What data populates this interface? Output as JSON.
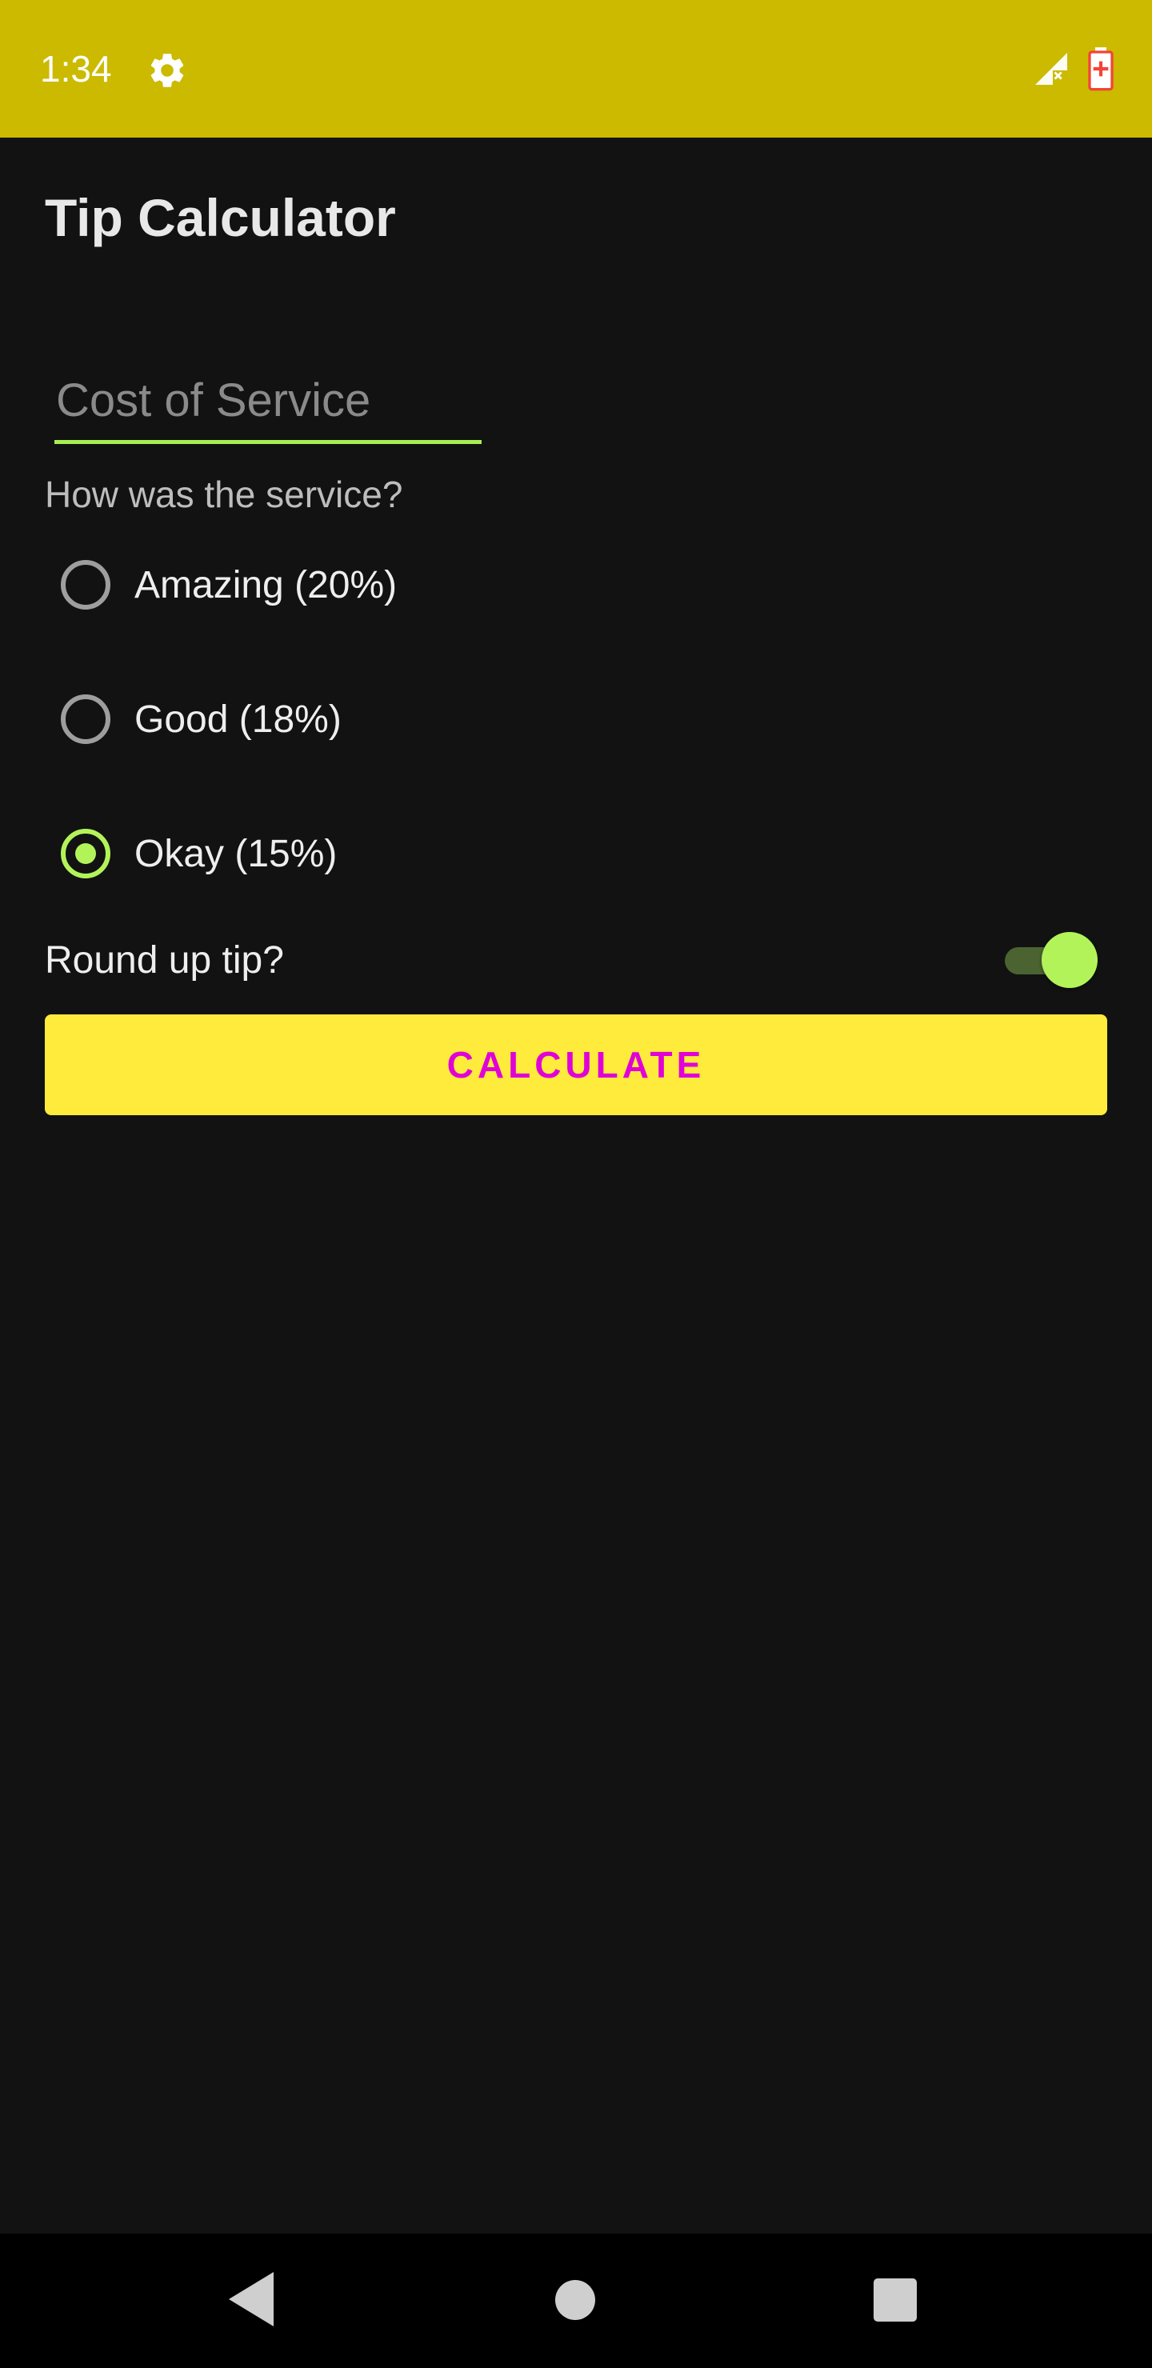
{
  "status_bar": {
    "time": "1:34",
    "background_color": "#cbba00",
    "icons": [
      "gear-icon",
      "signal-icon",
      "battery-icon"
    ]
  },
  "app": {
    "title": "Tip Calculator"
  },
  "cost_input": {
    "placeholder": "Cost of Service",
    "value": "",
    "accent_color": "#a6ef52"
  },
  "service": {
    "question": "How was the service?",
    "options": [
      {
        "label": "Amazing (20%)",
        "checked": false
      },
      {
        "label": "Good (18%)",
        "checked": false
      },
      {
        "label": "Okay (15%)",
        "checked": true
      }
    ]
  },
  "round_up": {
    "label": "Round up tip?",
    "enabled": true
  },
  "calculate_button": {
    "label": "CALCULATE",
    "background_color": "#ffeb3b",
    "text_color": "#e000d8"
  },
  "nav_bar": {
    "icons": [
      "back-icon",
      "home-icon",
      "recents-icon"
    ]
  }
}
